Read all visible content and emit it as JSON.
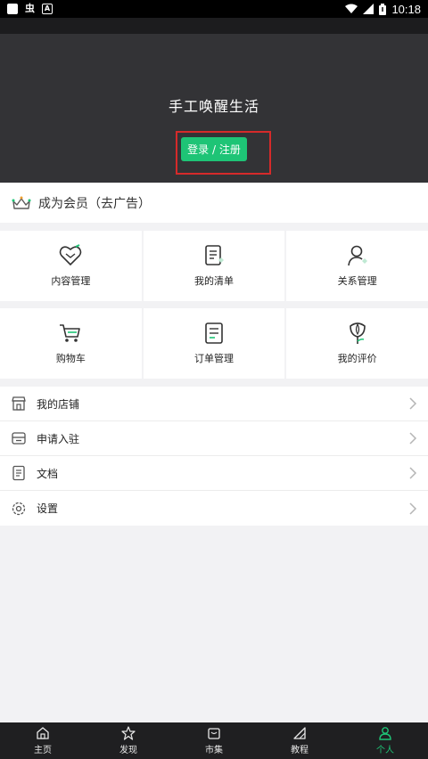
{
  "status_bar": {
    "time": "10:18",
    "carrier_glyph": "虫",
    "notif_glyph": "A"
  },
  "header": {
    "app_name": "手工唤醒生活",
    "login_button": "登录 / 注册"
  },
  "vip": {
    "label": "成为会员（去广告）"
  },
  "grid_row_1": [
    {
      "label": "内容管理",
      "icon": "heart-tag-icon"
    },
    {
      "label": "我的清单",
      "icon": "list-note-icon"
    },
    {
      "label": "关系管理",
      "icon": "user-relation-icon"
    }
  ],
  "grid_row_2": [
    {
      "label": "购物车",
      "icon": "cart-icon"
    },
    {
      "label": "订单管理",
      "icon": "order-icon"
    },
    {
      "label": "我的评价",
      "icon": "flower-review-icon"
    }
  ],
  "menu": [
    {
      "label": "我的店铺",
      "icon": "store-icon"
    },
    {
      "label": "申请入驻",
      "icon": "apply-icon"
    },
    {
      "label": "文档",
      "icon": "document-icon"
    },
    {
      "label": "设置",
      "icon": "settings-icon"
    }
  ],
  "tabbar": [
    {
      "label": "主页",
      "icon": "home-icon",
      "active": false
    },
    {
      "label": "发现",
      "icon": "discover-icon",
      "active": false
    },
    {
      "label": "市集",
      "icon": "market-icon",
      "active": false
    },
    {
      "label": "教程",
      "icon": "tutorial-icon",
      "active": false
    },
    {
      "label": "个人",
      "icon": "profile-icon",
      "active": true
    }
  ],
  "colors": {
    "accent": "#1ec476",
    "header_bg": "#333336",
    "highlight": "#d62a2a"
  }
}
